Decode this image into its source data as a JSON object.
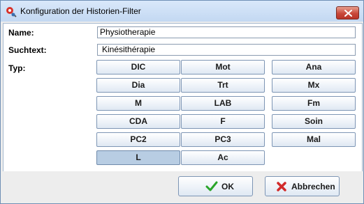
{
  "window": {
    "title": "Konfiguration der Historien-Filter"
  },
  "form": {
    "name_label": "Name:",
    "name_value": "Physiotherapie",
    "search_label": "Suchtext:",
    "search_value": "Kinésithérapie",
    "type_label": "Typ:"
  },
  "types": [
    {
      "label": "DIC",
      "selected": false
    },
    {
      "label": "Mot",
      "selected": false
    },
    {
      "label": "Ana",
      "selected": false
    },
    {
      "label": "Dia",
      "selected": false
    },
    {
      "label": "Trt",
      "selected": false
    },
    {
      "label": "Mx",
      "selected": false
    },
    {
      "label": "M",
      "selected": false
    },
    {
      "label": "LAB",
      "selected": false
    },
    {
      "label": "Fm",
      "selected": false
    },
    {
      "label": "CDA",
      "selected": false
    },
    {
      "label": "F",
      "selected": false
    },
    {
      "label": "Soin",
      "selected": false
    },
    {
      "label": "PC2",
      "selected": false
    },
    {
      "label": "PC3",
      "selected": false
    },
    {
      "label": "Mal",
      "selected": false
    },
    {
      "label": "L",
      "selected": true
    },
    {
      "label": "Ac",
      "selected": false
    }
  ],
  "actions": {
    "ok_label": "OK",
    "cancel_label": "Abbrechen"
  },
  "icons": {
    "ok": "check-icon",
    "cancel": "cross-icon",
    "app": "filter-app-icon",
    "close": "close-icon"
  },
  "colors": {
    "selected_type": "#b8cde3",
    "ok_check": "#2aa52a",
    "cancel_cross": "#d22a2a"
  }
}
